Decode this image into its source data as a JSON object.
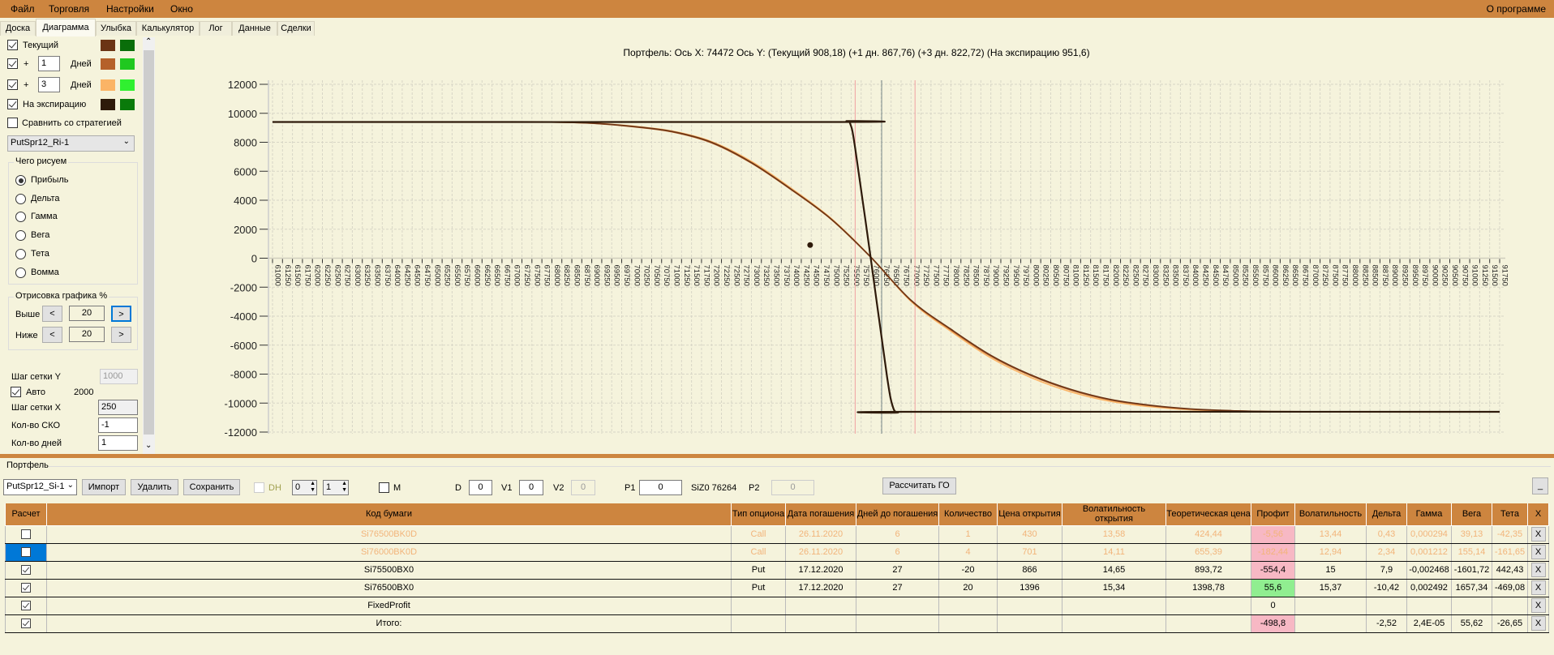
{
  "menu": {
    "items": [
      "Файл",
      "Торговля",
      "Настройки",
      "Окно"
    ],
    "about": "О программе"
  },
  "tabs": [
    "Доска",
    "Диаграмма",
    "Улыбка",
    "Калькулятор",
    "Лог",
    "Данные",
    "Сделки"
  ],
  "active_tab": "Диаграмма",
  "left_panel": {
    "current": {
      "label": "Текущий",
      "checked": true,
      "color1": "#6b3415",
      "color2": "#0a6e0a"
    },
    "plus1": {
      "plus": "+",
      "days": "1",
      "unit": "Дней",
      "checked": true,
      "color1": "#b5612a",
      "color2": "#20c820"
    },
    "plus3": {
      "plus": "+",
      "days": "3",
      "unit": "Дней",
      "checked": true,
      "color1": "#fbb466",
      "color2": "#30f030"
    },
    "expiration": {
      "label": "На экспирацию",
      "checked": true,
      "color1": "#2e1a0a",
      "color2": "#0a7a0a"
    },
    "compare": {
      "label": "Сравнить со стратегией",
      "checked": false
    },
    "strategy_select": "PutSpr12_Ri-1",
    "draw_group": {
      "title": "Чего рисуем",
      "options": [
        "Прибыль",
        "Дельта",
        "Гамма",
        "Вега",
        "Тета",
        "Вомма"
      ],
      "selected": "Прибыль"
    },
    "render_group": {
      "title": "Отрисовка графика %",
      "above_label": "Выше",
      "above_value": "20",
      "below_label": "Ниже",
      "below_value": "20",
      "prev": "<",
      "next": ">"
    },
    "grid_y_label": "Шаг сетки Y",
    "grid_y_value": "1000",
    "auto_label": "Авто",
    "auto_checked": true,
    "auto_value": "2000",
    "grid_x_label": "Шаг сетки X",
    "grid_x_value": "250",
    "sko_label": "Кол-во СКО",
    "sko_value": "-1",
    "days_label": "Кол-во дней",
    "days_value": "1"
  },
  "chart_data": {
    "type": "line",
    "title": "Портфель: Ось X: 74472 Ось Y:  (Текущий 908,18)  (+1 дн. 867,76)  (+3 дн. 822,72)  (На экспирацию 951,6)",
    "xlim": [
      61000,
      91750
    ],
    "x_tick_step": 250,
    "ylim": [
      -12000,
      12000
    ],
    "y_ticks": [
      12000,
      10000,
      8000,
      6000,
      4000,
      2000,
      0,
      -2000,
      -4000,
      -6000,
      -8000,
      -10000,
      -12000
    ],
    "grid": true,
    "series": [
      {
        "key": "current",
        "color": "#6b3415",
        "x": [
          61000,
          66000,
          68000,
          69000,
          70000,
          71000,
          72000,
          73000,
          74000,
          75000,
          76000,
          77000,
          78000,
          79000,
          80000,
          81000,
          82000,
          83000,
          84000,
          85000,
          86000,
          88000,
          91750
        ],
        "y": [
          9400,
          9400,
          9390,
          9320,
          9100,
          8750,
          8000,
          6600,
          4750,
          2700,
          50,
          -2900,
          -4900,
          -6700,
          -8050,
          -9050,
          -9750,
          -10150,
          -10400,
          -10520,
          -10580,
          -10600,
          -10600
        ]
      },
      {
        "key": "plus1",
        "color": "#b5612a",
        "x": [
          61000,
          66000,
          68000,
          69000,
          70000,
          71000,
          72000,
          73000,
          74000,
          75000,
          76000,
          77000,
          78000,
          79000,
          80000,
          81000,
          82000,
          83000,
          84000,
          85000,
          86000,
          88000,
          91750
        ],
        "y": [
          9400,
          9400,
          9390,
          9310,
          9080,
          8720,
          7960,
          6560,
          4720,
          2680,
          40,
          -2930,
          -4950,
          -6760,
          -8100,
          -9100,
          -9790,
          -10180,
          -10420,
          -10530,
          -10585,
          -10600,
          -10600
        ]
      },
      {
        "key": "plus3",
        "color": "#fbb466",
        "x": [
          61000,
          66000,
          68000,
          69000,
          70000,
          71000,
          72000,
          73000,
          74000,
          75000,
          76000,
          77000,
          78000,
          79000,
          80000,
          81000,
          82000,
          83000,
          84000,
          85000,
          86000,
          88000,
          91750
        ],
        "y": [
          9400,
          9400,
          9395,
          9330,
          9120,
          8780,
          8050,
          6680,
          4820,
          2740,
          60,
          -2980,
          -5050,
          -6880,
          -8230,
          -9220,
          -9880,
          -10250,
          -10460,
          -10550,
          -10590,
          -10600,
          -10600
        ]
      },
      {
        "key": "expiration",
        "color": "#2e1a0a",
        "x": [
          61000,
          75250,
          75380,
          75480,
          75600,
          76000,
          76400,
          76550,
          76680,
          76800,
          91750
        ],
        "y": [
          9400,
          9400,
          9460,
          9250,
          7600,
          -200,
          -8200,
          -10300,
          -10650,
          -10600,
          -10600
        ]
      }
    ],
    "marker": {
      "x": 74472,
      "y": 908.18,
      "color": "#2e1a0a"
    },
    "vertical_lines": [
      {
        "x": 75600,
        "color": "#f0a0a0"
      },
      {
        "x": 76264,
        "color": "#7a8a8a"
      },
      {
        "x": 77100,
        "color": "#f0a0a0"
      }
    ]
  },
  "portfolio": {
    "title": "Портфель",
    "select": "PutSpr12_Si-1",
    "import": "Импорт",
    "delete": "Удалить",
    "save": "Сохранить",
    "dh_label": "DH",
    "spin1": "0",
    "spin2": "1",
    "m_label": "M",
    "d_label": "D",
    "d_value": "0",
    "v1_label": "V1",
    "v1_value": "0",
    "v2_label": "V2",
    "v2_value": "0",
    "p1_label": "P1",
    "p1_value": "0",
    "underlying": "SiZ0 76264",
    "p2_label": "P2",
    "p2_value": "0",
    "calc_go": "Рассчитать ГО",
    "minimize": "_",
    "columns": [
      "Расчет",
      "Код бумаги",
      "Тип опциона",
      "Дата погашения",
      "Дней до погашения",
      "Количество",
      "Цена открытия",
      "Волатильность открытия",
      "Теоретическая цена",
      "Профит",
      "Волатильность",
      "Дельта",
      "Гамма",
      "Вега",
      "Тета",
      "X"
    ],
    "rows": [
      {
        "checked": false,
        "dim": true,
        "selected": false,
        "profit_bg": "pink",
        "cells": [
          "Si76500BK0D",
          "Call",
          "26.11.2020",
          "6",
          "1",
          "430",
          "13,58",
          "424,44",
          "-5,56",
          "13,44",
          "0,43",
          "0,000294",
          "39,13",
          "-42,35"
        ]
      },
      {
        "checked": false,
        "dim": true,
        "selected": true,
        "profit_bg": "pink",
        "cells": [
          "Si76000BK0D",
          "Call",
          "26.11.2020",
          "6",
          "4",
          "701",
          "14,11",
          "655,39",
          "-182,44",
          "12,94",
          "2,34",
          "0,001212",
          "155,14",
          "-161,65"
        ]
      },
      {
        "checked": true,
        "dim": false,
        "selected": false,
        "profit_bg": "pink",
        "cells": [
          "Si75500BX0",
          "Put",
          "17.12.2020",
          "27",
          "-20",
          "866",
          "14,65",
          "893,72",
          "-554,4",
          "15",
          "7,9",
          "-0,002468",
          "-1601,72",
          "442,43"
        ]
      },
      {
        "checked": true,
        "dim": false,
        "selected": false,
        "profit_bg": "green",
        "cells": [
          "Si76500BX0",
          "Put",
          "17.12.2020",
          "27",
          "20",
          "1396",
          "15,34",
          "1398,78",
          "55,6",
          "15,37",
          "-10,42",
          "0,002492",
          "1657,34",
          "-469,08"
        ]
      },
      {
        "checked": true,
        "dim": false,
        "selected": false,
        "profit_bg": "",
        "cells": [
          "FixedProfit",
          "",
          "",
          "",
          "",
          "",
          "",
          "",
          "0",
          "",
          "",
          "",
          "",
          ""
        ]
      },
      {
        "checked": true,
        "dim": false,
        "selected": false,
        "profit_bg": "pink",
        "cells": [
          "Итого:",
          "",
          "",
          "",
          "",
          "",
          "",
          "",
          "-498,8",
          "",
          "-2,52",
          "2,4E-05",
          "55,62",
          "-26,65"
        ]
      }
    ],
    "delete_row": "X"
  }
}
